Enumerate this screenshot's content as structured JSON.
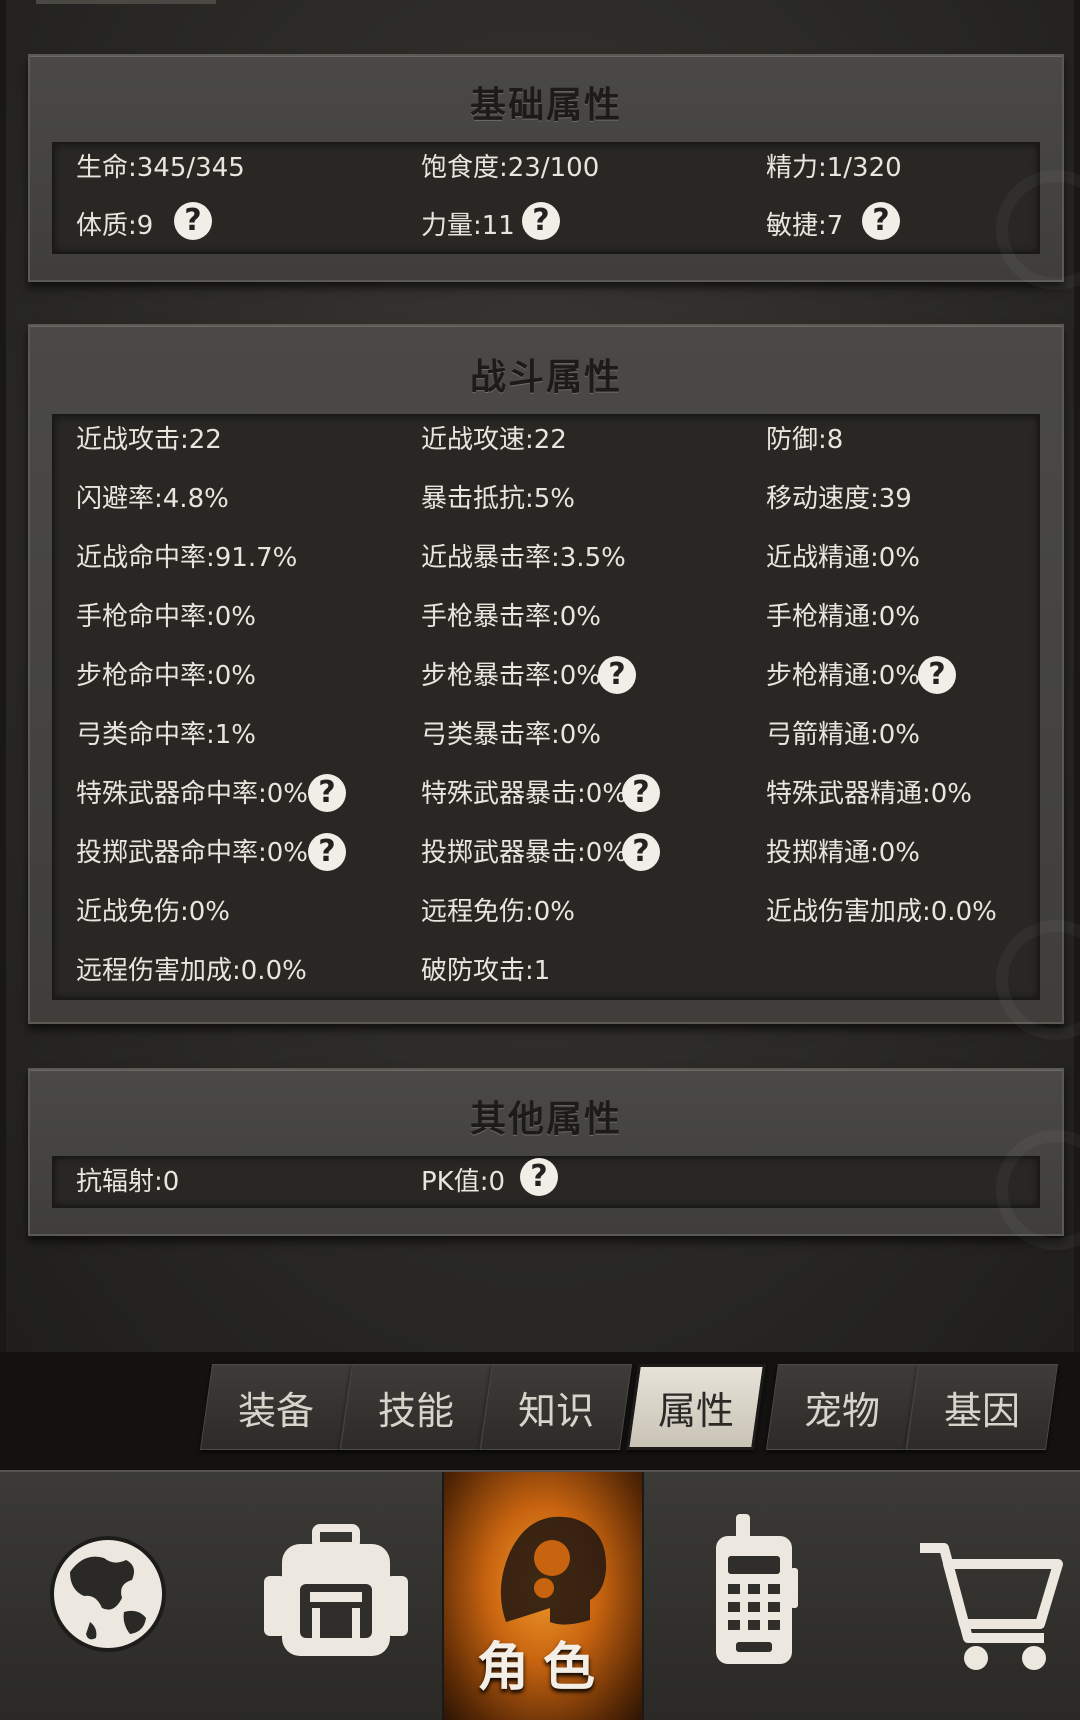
{
  "basic": {
    "title": "基础属性",
    "stats": [
      "生命:345/345",
      "饱食度:23/100",
      "精力:1/320",
      "体质:9",
      "力量:11",
      "敏捷:7"
    ]
  },
  "combat": {
    "title": "战斗属性",
    "stats": [
      "近战攻击:22",
      "近战攻速:22",
      "防御:8",
      "闪避率:4.8%",
      "暴击抵抗:5%",
      "移动速度:39",
      "近战命中率:91.7%",
      "近战暴击率:3.5%",
      "近战精通:0%",
      "手枪命中率:0%",
      "手枪暴击率:0%",
      "手枪精通:0%",
      "步枪命中率:0%",
      "步枪暴击率:0%",
      "步枪精通:0%",
      "弓类命中率:1%",
      "弓类暴击率:0%",
      "弓箭精通:0%",
      "特殊武器命中率:0%",
      "特殊武器暴击:0%",
      "特殊武器精通:0%",
      "投掷武器命中率:0%",
      "投掷武器暴击:0%",
      "投掷精通:0%",
      "近战免伤:0%",
      "远程免伤:0%",
      "近战伤害加成:0.0%",
      "远程伤害加成:0.0%",
      "破防攻击:1"
    ]
  },
  "other": {
    "title": "其他属性",
    "stats": [
      "抗辐射:0",
      "PK值:0"
    ]
  },
  "help_symbol": "?",
  "tabs": [
    "装备",
    "技能",
    "知识",
    "属性",
    "宠物",
    "基因"
  ],
  "active_tab": "属性",
  "nav": {
    "center_label": "角色",
    "icons": [
      "globe-icon",
      "backpack-icon",
      "character-icon",
      "walkie-talkie-icon",
      "cart-icon"
    ],
    "accent_color": "#e07a1a"
  }
}
